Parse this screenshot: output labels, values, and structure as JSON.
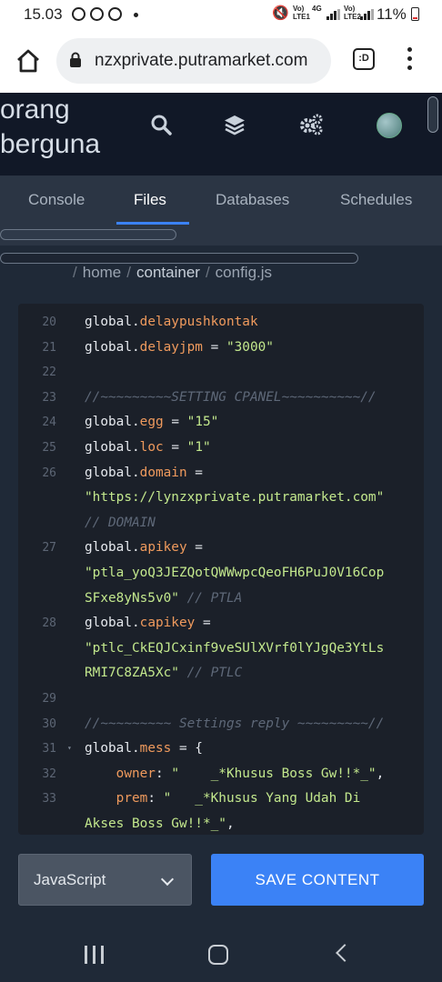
{
  "status_bar": {
    "time": "15.03",
    "net1": "Vo)\nLTE1",
    "net1_type": "4G",
    "net2": "Vo)\nLTE2",
    "battery": "11%",
    "icons": [
      "whatsapp-icon",
      "whatsapp-icon",
      "whatsapp-icon",
      "mute-icon",
      "signal-icon",
      "battery-icon"
    ]
  },
  "browser": {
    "url": "nzxprivate.putramarket.com",
    "tab_count": ":D"
  },
  "header": {
    "brand_line1": "orang",
    "brand_line2": "berguna"
  },
  "tabs": [
    {
      "label": "Console"
    },
    {
      "label": "Files"
    },
    {
      "label": "Databases"
    },
    {
      "label": "Schedules"
    }
  ],
  "active_tab": "Files",
  "breadcrumb": {
    "items": [
      "home",
      "container",
      "config.js"
    ]
  },
  "editor": {
    "lines": [
      {
        "n": "20",
        "parts": [
          [
            "global.",
            ""
          ],
          [
            "delaypushkontak",
            "prop"
          ]
        ]
      },
      {
        "n": "21",
        "parts": [
          [
            "global.",
            ""
          ],
          [
            "delayjpm",
            "prop"
          ],
          [
            " = ",
            ""
          ],
          [
            "\"3000\"",
            "str"
          ]
        ]
      },
      {
        "n": "22",
        "parts": []
      },
      {
        "n": "23",
        "parts": [
          [
            "//~~~~~~~~~SETTING CPANEL~~~~~~~~~~//",
            "cmt"
          ]
        ]
      },
      {
        "n": "24",
        "parts": [
          [
            "global.",
            ""
          ],
          [
            "egg",
            "prop"
          ],
          [
            " = ",
            ""
          ],
          [
            "\"15\"",
            "str"
          ]
        ]
      },
      {
        "n": "25",
        "parts": [
          [
            "global.",
            ""
          ],
          [
            "loc",
            "prop"
          ],
          [
            " = ",
            ""
          ],
          [
            "\"1\"",
            "str"
          ]
        ]
      },
      {
        "n": "26",
        "parts": [
          [
            "global.",
            ""
          ],
          [
            "domain",
            "prop"
          ],
          [
            " =",
            ""
          ]
        ]
      },
      {
        "n": "",
        "parts": [
          [
            "\"https://lynzxprivate.putramarket.com\"",
            "str"
          ]
        ]
      },
      {
        "n": "",
        "parts": [
          [
            "// DOMAIN",
            "cmt"
          ]
        ]
      },
      {
        "n": "27",
        "parts": [
          [
            "global.",
            ""
          ],
          [
            "apikey",
            "prop"
          ],
          [
            " =",
            ""
          ]
        ]
      },
      {
        "n": "",
        "parts": [
          [
            "\"ptla_yoQ3JEZQotQWWwpcQeoFH6PuJ0V16Cop",
            "str"
          ]
        ]
      },
      {
        "n": "",
        "parts": [
          [
            "SFxe8yNs5v0\"",
            "str"
          ],
          [
            " ",
            ""
          ],
          [
            "// PTLA",
            "cmt"
          ]
        ]
      },
      {
        "n": "28",
        "parts": [
          [
            "global.",
            ""
          ],
          [
            "capikey",
            "prop"
          ],
          [
            " =",
            ""
          ]
        ]
      },
      {
        "n": "",
        "parts": [
          [
            "\"ptlc_CkEQJCxinf9veSUlXVrf0lYJgQe3YtLs",
            "str"
          ]
        ]
      },
      {
        "n": "",
        "parts": [
          [
            "RMI7C8ZA5Xc\"",
            "str"
          ],
          [
            " ",
            ""
          ],
          [
            "// PTLC",
            "cmt"
          ]
        ]
      },
      {
        "n": "29",
        "parts": []
      },
      {
        "n": "30",
        "parts": [
          [
            "//~~~~~~~~~ Settings reply ~~~~~~~~~//",
            "cmt"
          ]
        ]
      },
      {
        "n": "31",
        "fold": "▾",
        "parts": [
          [
            "global.",
            ""
          ],
          [
            "mess",
            "prop"
          ],
          [
            " = {",
            ""
          ]
        ]
      },
      {
        "n": "32",
        "parts": [
          [
            "    ",
            ""
          ],
          [
            "owner",
            "prop"
          ],
          [
            ": ",
            ""
          ],
          [
            "\"    _*Khusus Boss Gw!!*_\"",
            "str"
          ],
          [
            ",",
            ""
          ]
        ]
      },
      {
        "n": "33",
        "parts": [
          [
            "    ",
            ""
          ],
          [
            "prem",
            "prop"
          ],
          [
            ": ",
            ""
          ],
          [
            "\"   _*Khusus Yang Udah Di",
            "str"
          ]
        ]
      },
      {
        "n": "",
        "parts": [
          [
            "Akses Boss Gw!!*_\"",
            "str"
          ],
          [
            ",",
            ""
          ]
        ]
      }
    ]
  },
  "controls": {
    "language": "JavaScript",
    "save_label": "SAVE CONTENT"
  }
}
